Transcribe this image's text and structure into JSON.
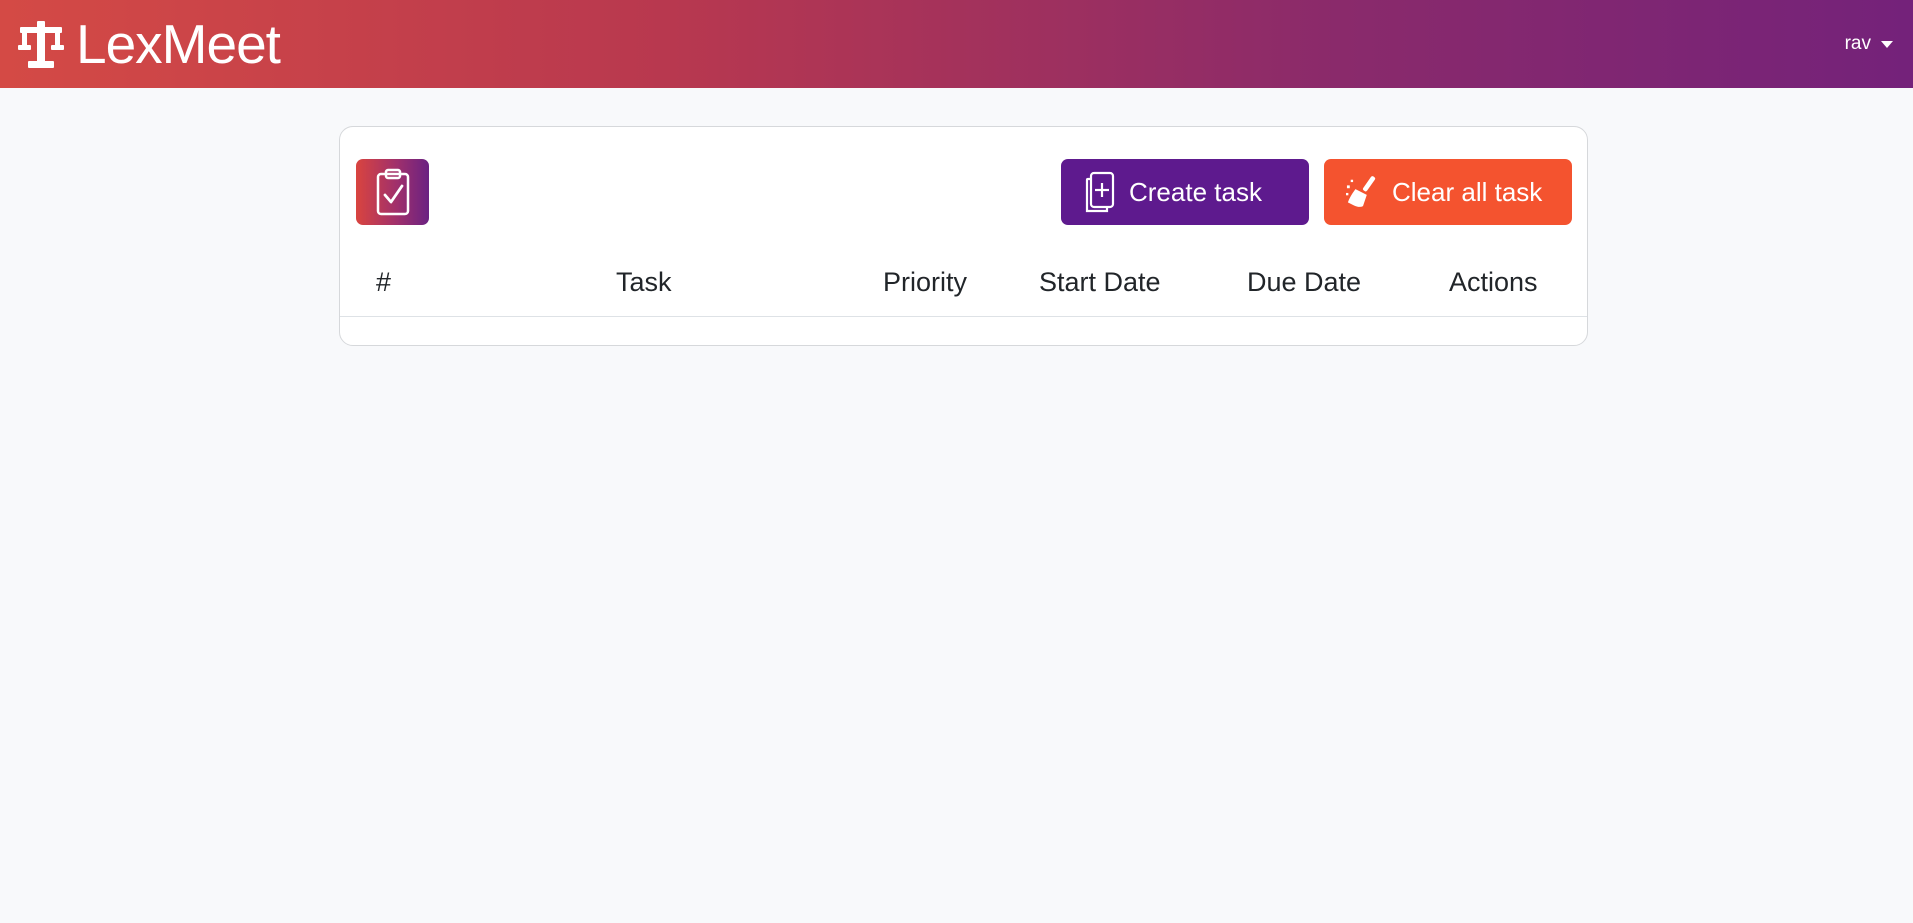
{
  "header": {
    "brand": "LexMeet",
    "brand_icon": "scales-of-justice-icon",
    "user": "rav",
    "gradient": [
      "#d44a45",
      "#74227a"
    ]
  },
  "toolbar": {
    "task_icon": "clipboard-check-icon",
    "create_label": "Create task",
    "create_icon": "document-plus-icon",
    "create_color": "#5e1a8e",
    "clear_label": "Clear all task",
    "clear_icon": "broom-icon",
    "clear_color": "#f4532f"
  },
  "table": {
    "columns": [
      "#",
      "Task",
      "Priority",
      "Start Date",
      "Due Date",
      "Actions"
    ],
    "rows": []
  }
}
